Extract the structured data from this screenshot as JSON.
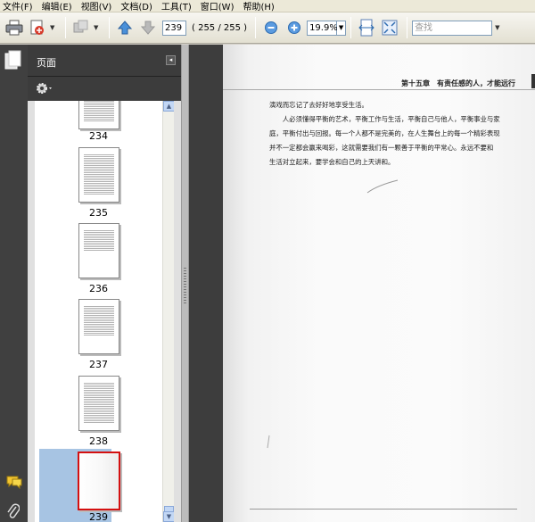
{
  "menu": [
    {
      "label": "文件(F)"
    },
    {
      "label": "编辑(E)"
    },
    {
      "label": "视图(V)"
    },
    {
      "label": "文档(D)"
    },
    {
      "label": "工具(T)"
    },
    {
      "label": "窗口(W)"
    },
    {
      "label": "帮助(H)"
    }
  ],
  "toolbar": {
    "current_page": "239",
    "page_count": "( 255 / 255 )",
    "zoom": "19.9%",
    "search_placeholder": "查找"
  },
  "panel": {
    "title": "页面"
  },
  "thumbnails": [
    {
      "label": "234"
    },
    {
      "label": "235"
    },
    {
      "label": "236"
    },
    {
      "label": "237"
    },
    {
      "label": "238"
    },
    {
      "label": "239",
      "selected": true
    }
  ],
  "document": {
    "running_head": "第十五章　有责任感的人，才能远行",
    "lines": [
      "演戏而忘记了去好好地享受生活。",
      "　　人必须懂得平衡的艺术，平衡工作与生活，平衡自己与他人，平衡事业与家",
      "庭，平衡付出与回报。每一个人都不是完美的，在人生舞台上的每一个精彩表现",
      "并不一定都会赢来喝彩，这就需要我们有一颗善于平衡的平常心。永远不要和",
      "生活对立起来，要学会和自己的上天讲和。"
    ]
  },
  "colors": {
    "selection": "#a7c4e3",
    "selected_border": "#d41010",
    "dark_panel": "#3c3c3c"
  }
}
